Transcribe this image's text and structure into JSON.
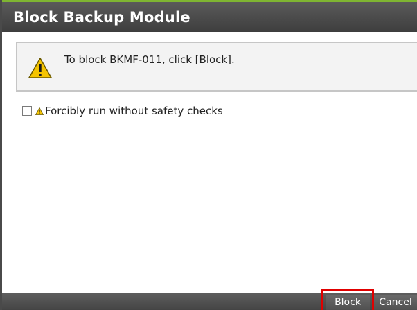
{
  "dialog": {
    "title": "Block Backup Module",
    "message": "To block BKMF-011, click [Block].",
    "option_label": "Forcibly run without safety checks",
    "option_checked": false
  },
  "buttons": {
    "block": "Block",
    "cancel": "Cancel"
  },
  "colors": {
    "title_bar": "#4a4a4a",
    "accent_top": "#7fb532",
    "warning_fill": "#f5c400",
    "highlight": "#e00000"
  },
  "icons": {
    "message": "warning-triangle-icon",
    "option": "warning-small-icon"
  }
}
